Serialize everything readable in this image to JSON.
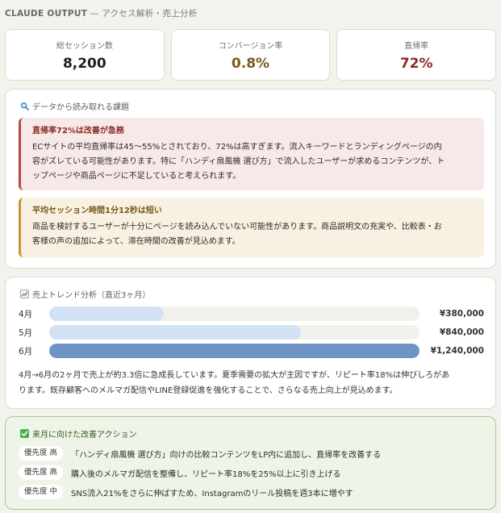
{
  "header": {
    "brand": "CLAUDE OUTPUT",
    "subtitle": " — アクセス解析・売上分析"
  },
  "kpis": [
    {
      "label": "総セッション数",
      "value": "8,200",
      "color": "#1f1f1f"
    },
    {
      "label": "コンバージョン率",
      "value": "0.8%",
      "color": "#7a5a18"
    },
    {
      "label": "直帰率",
      "value": "72%",
      "color": "#8a2f26"
    }
  ],
  "issues": {
    "title": "データから読み取れる課題",
    "icon": "magnifier-icon",
    "items": [
      {
        "title": "直帰率72%は改善が急務",
        "lines": [
          "ECサイトの平均直帰率は45〜55%とされており、72%は高すぎます。流入キーワードとランディングページの内",
          "容がズレている可能性があります。特に「ハンディ扇風機 選び方」で流入したユーザーが求めるコンテンツが、ト",
          "ップページや商品ページに不足していると考えられます。"
        ]
      },
      {
        "title": "平均セッション時間1分12秒は短い",
        "lines": [
          "商品を検討するユーザーが十分にページを読み込んでいない可能性があります。商品説明文の充実や、比較表・お",
          "客様の声の追加によって、滞在時間の改善が見込めます。"
        ]
      }
    ]
  },
  "trend": {
    "title": "売上トレンド分析（直近3ヶ月）",
    "icon": "chart-icon",
    "rows": [
      {
        "month": "4月",
        "amount": "¥380,000",
        "fill": 0.31,
        "color": "#d3e1f5"
      },
      {
        "month": "5月",
        "amount": "¥840,000",
        "fill": 0.68,
        "color": "#d3e1f5"
      },
      {
        "month": "6月",
        "amount": "¥1,240,000",
        "fill": 1.0,
        "color": "#6f93c4"
      }
    ],
    "lines": [
      "4月→6月の2ヶ月で売上が約3.3倍に急成長しています。夏季需要の拡大が主因ですが、リピート率18%は伸びしろがあ",
      "ります。既存顧客へのメルマガ配信やLINE登録促進を強化することで、さらなる売上向上が見込めます。"
    ]
  },
  "actions": {
    "title": "来月に向けた改善アクション",
    "icon": "check-icon",
    "items": [
      {
        "priority": "優先度 高",
        "text": "「ハンディ扇風機 選び方」向けの比較コンテンツをLP内に追加し、直帰率を改善する"
      },
      {
        "priority": "優先度 高",
        "text": "購入後のメルマガ配信を整備し、リピート率18%を25%以上に引き上げる"
      },
      {
        "priority": "優先度 中",
        "text": "SNS流入21%をさらに伸ばすため、Instagramのリール投稿を週3本に増やす"
      }
    ]
  }
}
